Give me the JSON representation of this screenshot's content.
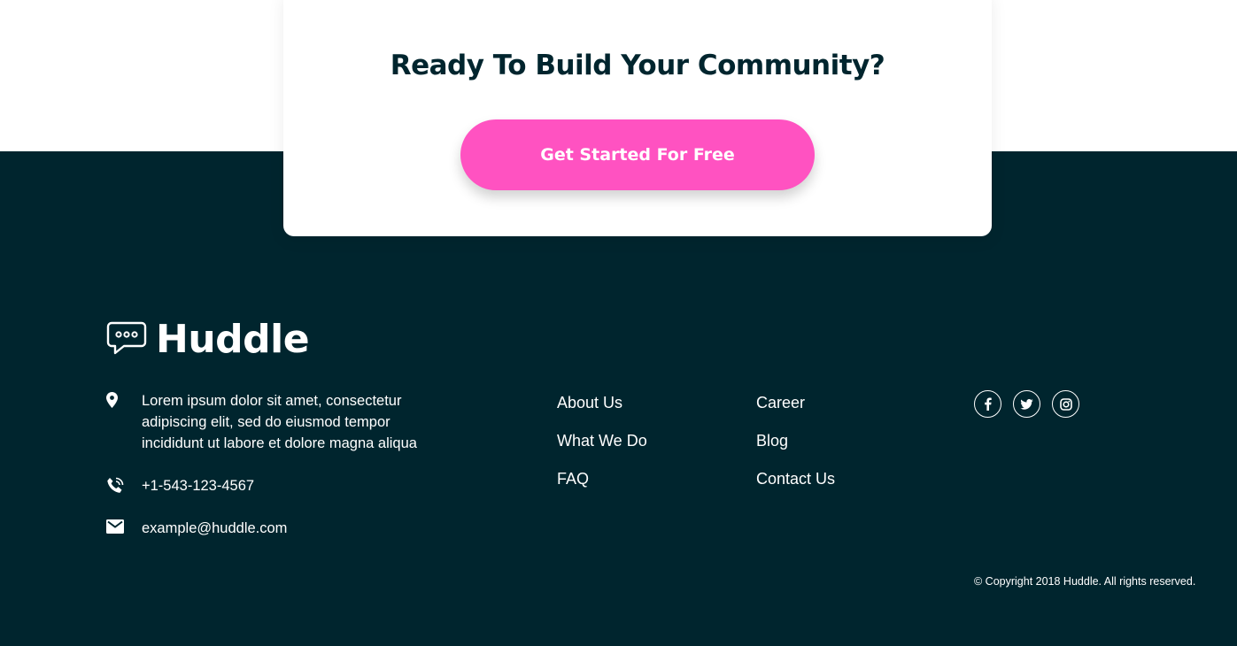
{
  "cta": {
    "title": "Ready To Build Your Community?",
    "button_label": "Get Started For Free",
    "button_color": "#ff52c1"
  },
  "footer": {
    "logo": {
      "icon": "chat-bubble-icon",
      "text": "Huddle"
    },
    "contact": {
      "address": "Lorem ipsum dolor sit amet, consectetur adipiscing elit, sed do eiusmod tempor incididunt ut labore et dolore magna aliqua",
      "phone": "+1-543-123-4567",
      "email": "example@huddle.com"
    },
    "links_col1": [
      "About Us",
      "What We Do",
      "FAQ"
    ],
    "links_col2": [
      "Career",
      "Blog",
      "Contact Us"
    ],
    "socials": [
      "facebook-icon",
      "twitter-icon",
      "instagram-icon"
    ],
    "copyright": "© Copyright 2018 Huddle. All rights reserved.",
    "background_color": "#00252e"
  }
}
